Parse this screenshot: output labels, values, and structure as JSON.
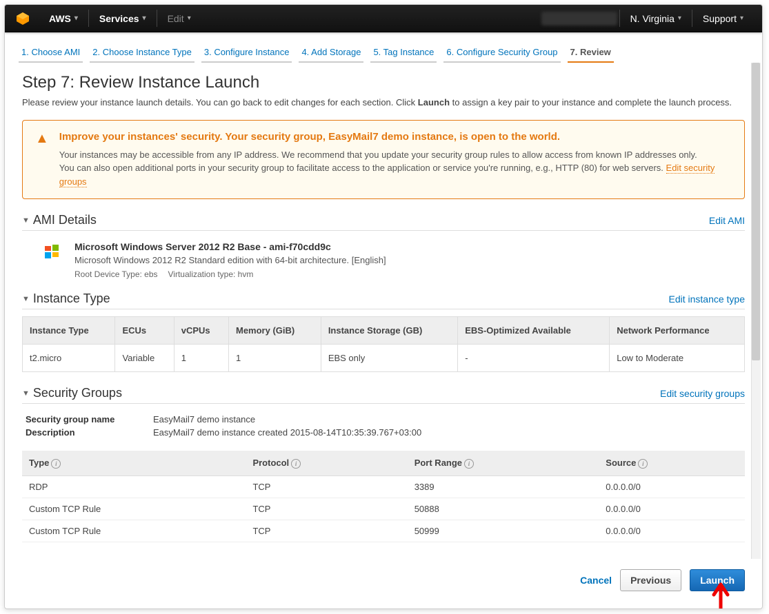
{
  "topbar": {
    "brand": "AWS",
    "services": "Services",
    "edit": "Edit",
    "region": "N. Virginia",
    "support": "Support"
  },
  "wizard": [
    "1. Choose AMI",
    "2. Choose Instance Type",
    "3. Configure Instance",
    "4. Add Storage",
    "5. Tag Instance",
    "6. Configure Security Group",
    "7. Review"
  ],
  "step": {
    "title": "Step 7: Review Instance Launch",
    "desc_pre": "Please review your instance launch details. You can go back to edit changes for each section. Click ",
    "desc_bold": "Launch",
    "desc_post": " to assign a key pair to your instance and complete the launch process."
  },
  "alert": {
    "title": "Improve your instances' security. Your security group, EasyMail7 demo instance, is open to the world.",
    "line1": "Your instances may be accessible from any IP address. We recommend that you update your security group rules to allow access from known IP addresses only.",
    "line2_pre": "You can also open additional ports in your security group to facilitate access to the application or service you're running, e.g., HTTP (80) for web servers. ",
    "link": "Edit security groups"
  },
  "ami": {
    "section": "AMI Details",
    "edit": "Edit AMI",
    "name": "Microsoft Windows Server 2012 R2 Base - ami-f70cdd9c",
    "desc": "Microsoft Windows 2012 R2 Standard edition with 64-bit architecture. [English]",
    "root": "Root Device Type: ebs",
    "virt": "Virtualization type: hvm"
  },
  "itype": {
    "section": "Instance Type",
    "edit": "Edit instance type",
    "headers": [
      "Instance Type",
      "ECUs",
      "vCPUs",
      "Memory (GiB)",
      "Instance Storage (GB)",
      "EBS-Optimized Available",
      "Network Performance"
    ],
    "row": [
      "t2.micro",
      "Variable",
      "1",
      "1",
      "EBS only",
      "-",
      "Low to Moderate"
    ]
  },
  "sg": {
    "section": "Security Groups",
    "edit": "Edit security groups",
    "name_label": "Security group name",
    "name_value": "EasyMail7 demo instance",
    "desc_label": "Description",
    "desc_value": "EasyMail7 demo instance created 2015-08-14T10:35:39.767+03:00",
    "headers": [
      "Type",
      "Protocol",
      "Port Range",
      "Source"
    ],
    "rules": [
      [
        "RDP",
        "TCP",
        "3389",
        "0.0.0.0/0"
      ],
      [
        "Custom TCP Rule",
        "TCP",
        "50888",
        "0.0.0.0/0"
      ],
      [
        "Custom TCP Rule",
        "TCP",
        "50999",
        "0.0.0.0/0"
      ]
    ]
  },
  "footer": {
    "cancel": "Cancel",
    "previous": "Previous",
    "launch": "Launch"
  }
}
